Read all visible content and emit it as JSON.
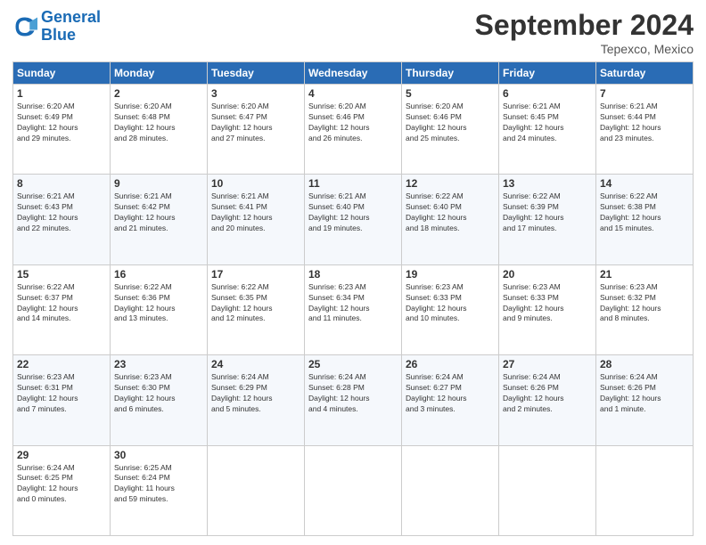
{
  "logo": {
    "line1": "General",
    "line2": "Blue"
  },
  "title": "September 2024",
  "location": "Tepexco, Mexico",
  "days_of_week": [
    "Sunday",
    "Monday",
    "Tuesday",
    "Wednesday",
    "Thursday",
    "Friday",
    "Saturday"
  ],
  "weeks": [
    [
      {
        "day": "1",
        "info": "Sunrise: 6:20 AM\nSunset: 6:49 PM\nDaylight: 12 hours\nand 29 minutes."
      },
      {
        "day": "2",
        "info": "Sunrise: 6:20 AM\nSunset: 6:48 PM\nDaylight: 12 hours\nand 28 minutes."
      },
      {
        "day": "3",
        "info": "Sunrise: 6:20 AM\nSunset: 6:47 PM\nDaylight: 12 hours\nand 27 minutes."
      },
      {
        "day": "4",
        "info": "Sunrise: 6:20 AM\nSunset: 6:46 PM\nDaylight: 12 hours\nand 26 minutes."
      },
      {
        "day": "5",
        "info": "Sunrise: 6:20 AM\nSunset: 6:46 PM\nDaylight: 12 hours\nand 25 minutes."
      },
      {
        "day": "6",
        "info": "Sunrise: 6:21 AM\nSunset: 6:45 PM\nDaylight: 12 hours\nand 24 minutes."
      },
      {
        "day": "7",
        "info": "Sunrise: 6:21 AM\nSunset: 6:44 PM\nDaylight: 12 hours\nand 23 minutes."
      }
    ],
    [
      {
        "day": "8",
        "info": "Sunrise: 6:21 AM\nSunset: 6:43 PM\nDaylight: 12 hours\nand 22 minutes."
      },
      {
        "day": "9",
        "info": "Sunrise: 6:21 AM\nSunset: 6:42 PM\nDaylight: 12 hours\nand 21 minutes."
      },
      {
        "day": "10",
        "info": "Sunrise: 6:21 AM\nSunset: 6:41 PM\nDaylight: 12 hours\nand 20 minutes."
      },
      {
        "day": "11",
        "info": "Sunrise: 6:21 AM\nSunset: 6:40 PM\nDaylight: 12 hours\nand 19 minutes."
      },
      {
        "day": "12",
        "info": "Sunrise: 6:22 AM\nSunset: 6:40 PM\nDaylight: 12 hours\nand 18 minutes."
      },
      {
        "day": "13",
        "info": "Sunrise: 6:22 AM\nSunset: 6:39 PM\nDaylight: 12 hours\nand 17 minutes."
      },
      {
        "day": "14",
        "info": "Sunrise: 6:22 AM\nSunset: 6:38 PM\nDaylight: 12 hours\nand 15 minutes."
      }
    ],
    [
      {
        "day": "15",
        "info": "Sunrise: 6:22 AM\nSunset: 6:37 PM\nDaylight: 12 hours\nand 14 minutes."
      },
      {
        "day": "16",
        "info": "Sunrise: 6:22 AM\nSunset: 6:36 PM\nDaylight: 12 hours\nand 13 minutes."
      },
      {
        "day": "17",
        "info": "Sunrise: 6:22 AM\nSunset: 6:35 PM\nDaylight: 12 hours\nand 12 minutes."
      },
      {
        "day": "18",
        "info": "Sunrise: 6:23 AM\nSunset: 6:34 PM\nDaylight: 12 hours\nand 11 minutes."
      },
      {
        "day": "19",
        "info": "Sunrise: 6:23 AM\nSunset: 6:33 PM\nDaylight: 12 hours\nand 10 minutes."
      },
      {
        "day": "20",
        "info": "Sunrise: 6:23 AM\nSunset: 6:33 PM\nDaylight: 12 hours\nand 9 minutes."
      },
      {
        "day": "21",
        "info": "Sunrise: 6:23 AM\nSunset: 6:32 PM\nDaylight: 12 hours\nand 8 minutes."
      }
    ],
    [
      {
        "day": "22",
        "info": "Sunrise: 6:23 AM\nSunset: 6:31 PM\nDaylight: 12 hours\nand 7 minutes."
      },
      {
        "day": "23",
        "info": "Sunrise: 6:23 AM\nSunset: 6:30 PM\nDaylight: 12 hours\nand 6 minutes."
      },
      {
        "day": "24",
        "info": "Sunrise: 6:24 AM\nSunset: 6:29 PM\nDaylight: 12 hours\nand 5 minutes."
      },
      {
        "day": "25",
        "info": "Sunrise: 6:24 AM\nSunset: 6:28 PM\nDaylight: 12 hours\nand 4 minutes."
      },
      {
        "day": "26",
        "info": "Sunrise: 6:24 AM\nSunset: 6:27 PM\nDaylight: 12 hours\nand 3 minutes."
      },
      {
        "day": "27",
        "info": "Sunrise: 6:24 AM\nSunset: 6:26 PM\nDaylight: 12 hours\nand 2 minutes."
      },
      {
        "day": "28",
        "info": "Sunrise: 6:24 AM\nSunset: 6:26 PM\nDaylight: 12 hours\nand 1 minute."
      }
    ],
    [
      {
        "day": "29",
        "info": "Sunrise: 6:24 AM\nSunset: 6:25 PM\nDaylight: 12 hours\nand 0 minutes."
      },
      {
        "day": "30",
        "info": "Sunrise: 6:25 AM\nSunset: 6:24 PM\nDaylight: 11 hours\nand 59 minutes."
      },
      {
        "day": "",
        "info": ""
      },
      {
        "day": "",
        "info": ""
      },
      {
        "day": "",
        "info": ""
      },
      {
        "day": "",
        "info": ""
      },
      {
        "day": "",
        "info": ""
      }
    ]
  ]
}
